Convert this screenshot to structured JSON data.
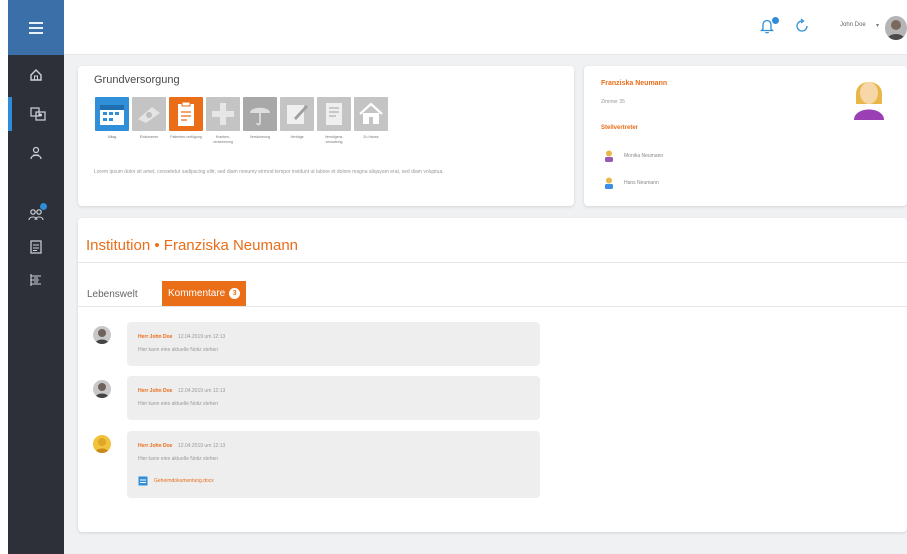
{
  "topbar": {
    "user_label": "John Doe",
    "user_chevron": "▾",
    "icons": [
      "bell-icon",
      "refresh-icon",
      "user-avatar"
    ]
  },
  "sidebar": {
    "items": [
      {
        "icon": "menu-icon"
      },
      {
        "icon": "home-icon"
      },
      {
        "icon": "residents-icon",
        "active": true
      },
      {
        "icon": "care-icon"
      },
      {
        "icon": "team-icon",
        "badge": true
      },
      {
        "icon": "document-icon"
      },
      {
        "icon": "list-icon"
      }
    ]
  },
  "grundversorgung": {
    "title": "Grundversorgung",
    "tiles": [
      {
        "label": "Alltag",
        "icon": "calendar-icon",
        "color": "blue"
      },
      {
        "label": "Einkommen",
        "icon": "money-icon",
        "color": "grey"
      },
      {
        "label": "Patienten-verfügung",
        "icon": "clipboard-icon",
        "color": "orange"
      },
      {
        "label": "Kranken-versicherung",
        "icon": "health-icon",
        "color": "grey"
      },
      {
        "label": "Versicherung",
        "icon": "umbrella-icon",
        "color": "grey2"
      },
      {
        "label": "Verträge",
        "icon": "contract-icon",
        "color": "grey"
      },
      {
        "label": "Vermögens-verwaltung",
        "icon": "wealth-doc-icon",
        "color": "grey"
      },
      {
        "label": "Zu Hause",
        "icon": "house-icon",
        "color": "grey"
      }
    ],
    "description": "Lorem ipsum dolor sit amet, consetetur sadipscing elitr, sed diam nonumy eirmod tempor invidunt ut labore et dolore magna aliquyam erat, sed diam voluptua."
  },
  "person": {
    "name": "Franziska Neumann",
    "room": "Zimmer 35",
    "stellvertreter_title": "Stellvertreter",
    "contacts": [
      {
        "name": "Monika Neumann"
      },
      {
        "name": "Hans Neumann"
      }
    ]
  },
  "main": {
    "title": "Institution • Franziska Neumann",
    "tabs": [
      {
        "label": "Lebenswelt",
        "active": false
      },
      {
        "label": "Kommentare",
        "active": true,
        "count": "3"
      }
    ]
  },
  "comments": [
    {
      "author": "Herr John Doe",
      "date": "12.04.2019 um 12:13",
      "text": "Hier kann eine aktuelle Notiz stehen",
      "avatar_color": "#8a8a8a"
    },
    {
      "author": "Herr John Doe",
      "date": "12.04.2019 um 12:13",
      "text": "Hier kann eine aktuelle Notiz stehen",
      "avatar_color": "#8a8a8a"
    },
    {
      "author": "Herr John Doe",
      "date": "12.04.2019 um 12:13",
      "text": "Hier kann eine aktuelle Notiz stehen",
      "avatar_color": "#e0a626",
      "attachment": "Geheimdokumentung.docx"
    }
  ],
  "colors": {
    "accent": "#ea6d18",
    "blue": "#2f8fd8",
    "sidebar": "#2d3038",
    "menu": "#3b6fa8"
  }
}
